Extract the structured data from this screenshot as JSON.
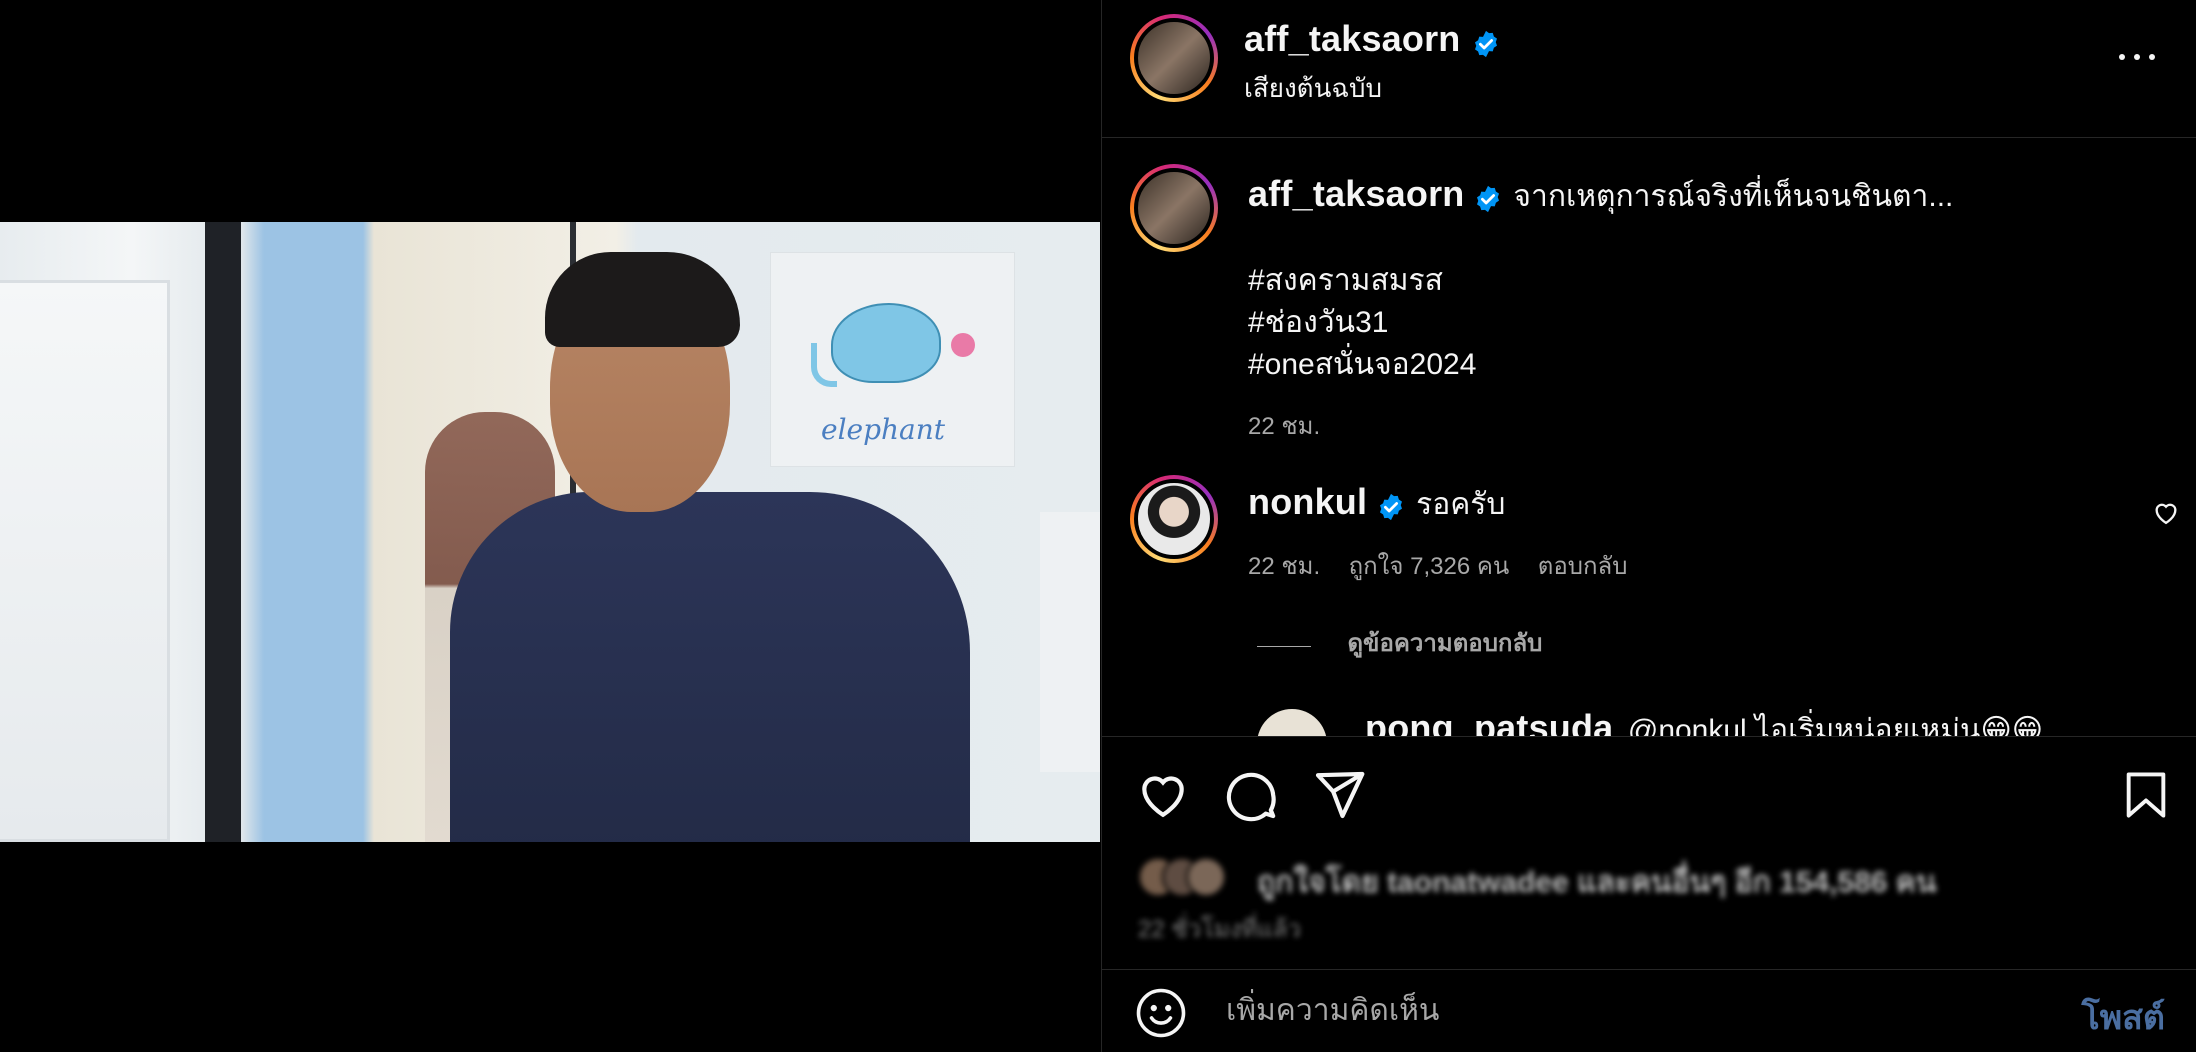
{
  "post": {
    "author": "aff_taksaorn",
    "audio_label": "เสียงต้นฉบับ",
    "caption": "จากเหตุการณ์จริงที่เห็นจนชินตา...",
    "hashtags": [
      "#สงครามสมรส",
      "#ช่องวัน31",
      "#oneสนั่นจอ2024"
    ],
    "caption_time": "22 ชม.",
    "drawing_text": "elephant"
  },
  "comments": [
    {
      "username": "nonkul",
      "text": "รอครับ",
      "time": "22 ชม.",
      "likes": "ถูกใจ 7,326 คน",
      "reply_label": "ตอบกลับ",
      "view_replies": "ดูข้อความตอบกลับ"
    },
    {
      "username": "pong_patsuda",
      "text": "@nonkul ไอเริ่มหน่อยเหม่น😁😁"
    }
  ],
  "engagement": {
    "liked_by": "ถูกใจโดย taonatwadee และคนอื่นๆ อีก 154,586 คน",
    "posted_ago": "22 ชั่วโมงที่แล้ว"
  },
  "composer": {
    "placeholder": "เพิ่มความคิดเห็น",
    "post_label": "โพสต์"
  },
  "colors": {
    "verified": "#0095f6",
    "post_button": "#4a6ea1",
    "muted_text": "#a8a8a8"
  }
}
